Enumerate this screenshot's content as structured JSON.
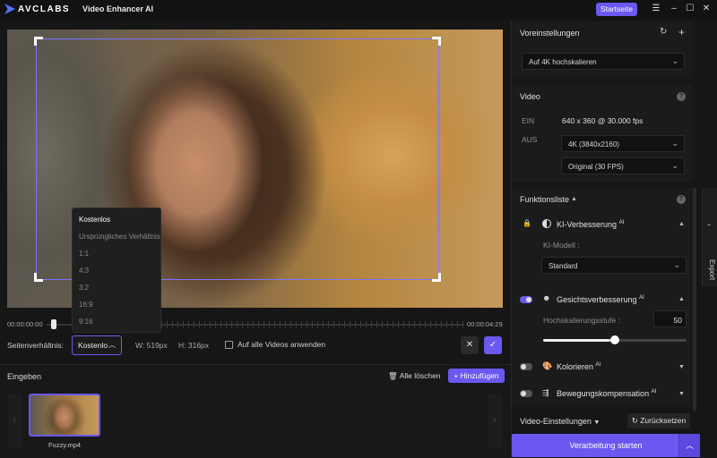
{
  "titlebar": {
    "logo_text": "AVCLABS",
    "app_title": "Video Enhancer AI",
    "startseite_label": "Startseite",
    "menu_icon": "hamburger-icon",
    "minimize_icon": "minimize-icon",
    "maximize_icon": "maximize-icon",
    "close_icon": "close-icon"
  },
  "timeline": {
    "start": "00:00:00:00",
    "end": "00:00:04:29"
  },
  "aspect": {
    "label": "Seitenverhältnis:",
    "selected": "Kostenlo",
    "width_label": "W:",
    "width_value": "519px",
    "height_label": "H:",
    "height_value": "316px",
    "apply_all_label": "Auf alle Videos anwenden",
    "menu": [
      "Kostenlos",
      "Ursprüngliches Verhältnis",
      "1:1",
      "4:3",
      "3:2",
      "16:9",
      "9:16"
    ]
  },
  "input": {
    "title": "Eingeben",
    "clear_all": "Alle löschen",
    "add": "Hinzufügen",
    "file_name": "Fuzzy.mp4"
  },
  "presets": {
    "title": "Voreinstellungen",
    "selected": "Auf 4K hochskalieren"
  },
  "video": {
    "title": "Video",
    "in_label": "EIN",
    "in_value": "640 x 360 @ 30.000 fps",
    "out_label": "AUS",
    "resolution": "4K (3840x2160)",
    "fps": "Original (30 FPS)"
  },
  "features": {
    "title": "Funktionsliste",
    "ai_enhance": {
      "title": "KI-Verbesserung",
      "badge": "AI",
      "model_label": "KI-Modell :",
      "model": "Standard"
    },
    "face": {
      "title": "Gesichtsverbesserung",
      "badge": "AI",
      "scale_label": "Hochskalierungsstufe :",
      "scale_value": "50",
      "slider_level": 0.5
    },
    "colorize": {
      "title": "Kolorieren",
      "badge": "AI"
    },
    "motion": {
      "title": "Bewegungskompensation",
      "badge": "AI"
    }
  },
  "footer": {
    "video_settings": "Video-Einstellungen",
    "reset": "Zurücksetzen",
    "process": "Verarbeitung starten",
    "export": "Export"
  }
}
